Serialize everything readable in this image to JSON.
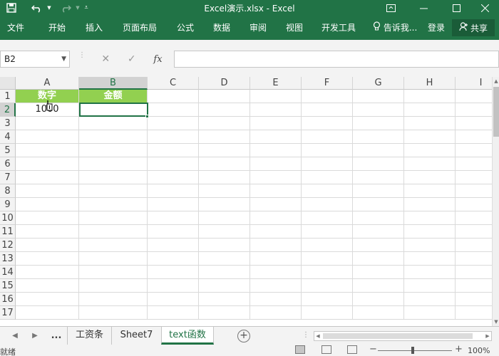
{
  "titlebar": {
    "title": "Excel演示.xlsx - Excel",
    "save_icon": "save-icon",
    "undo_icon": "undo-icon",
    "redo_icon": "redo-icon",
    "customize_icon": "customize-qat-icon"
  },
  "window_controls": [
    "ribbon-display-icon",
    "minimize-icon",
    "maximize-icon",
    "close-icon"
  ],
  "ribbon": {
    "tabs": [
      "文件",
      "开始",
      "插入",
      "页面布局",
      "公式",
      "数据",
      "审阅",
      "视图",
      "开发工具"
    ],
    "tell_me": "告诉我...",
    "signin": "登录",
    "share": "共享"
  },
  "formula_bar": {
    "name_box": "B2",
    "fx_label": "fx",
    "formula_value": ""
  },
  "grid": {
    "columns": [
      "A",
      "B",
      "C",
      "D",
      "E",
      "F",
      "G",
      "H",
      "I"
    ],
    "rows": [
      "1",
      "2",
      "3",
      "4",
      "5",
      "6",
      "7",
      "8",
      "9",
      "10",
      "11",
      "12",
      "13",
      "14",
      "15",
      "16",
      "17"
    ],
    "selected_cell": "B2",
    "cells": {
      "A1": "数字",
      "B1": "金额",
      "A2": "1000",
      "B2": ""
    },
    "header_fill": "#92d050",
    "accent": "#217346"
  },
  "sheets": {
    "more": "...",
    "tabs": [
      "工资条",
      "Sheet7",
      "text函数"
    ],
    "active": "text函数"
  },
  "status": {
    "ready": "就绪",
    "zoom": "100%",
    "zoom_minus": "−",
    "zoom_plus": "+"
  }
}
